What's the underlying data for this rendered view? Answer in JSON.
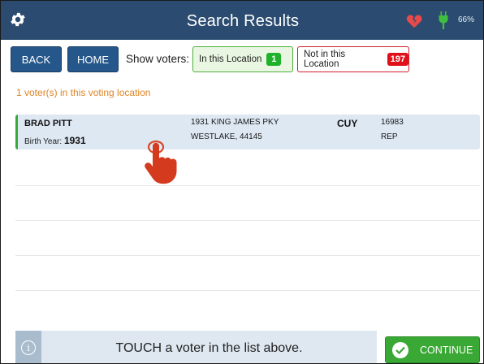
{
  "header": {
    "title": "Search Results",
    "battery_percent": "66%",
    "icons": [
      "gear-icon",
      "broken-heart-icon",
      "plug-icon"
    ],
    "colors": {
      "bar": "#2b4c70",
      "heart": "#e8494a",
      "plug": "#3fbf3f"
    }
  },
  "toolbar": {
    "back_label": "BACK",
    "home_label": "HOME",
    "show_voters_label": "Show voters:",
    "in_location": {
      "label": "In this Location",
      "count": "1"
    },
    "not_in_location": {
      "label": "Not in this Location",
      "count": "197"
    }
  },
  "count_text": "1 voter(s) in this voting location",
  "voters": [
    {
      "name": "BRAD PITT",
      "birth_label": "Birth Year:",
      "birth_year": "1931",
      "address_line1": "1931 KING JAMES PKY",
      "address_line2": "WESTLAKE, 44145",
      "county": "CUY",
      "voter_id": "16983",
      "party": "REP"
    }
  ],
  "footer": {
    "hint": "TOUCH a voter in the list above.",
    "continue_label": "CONTINUE"
  }
}
